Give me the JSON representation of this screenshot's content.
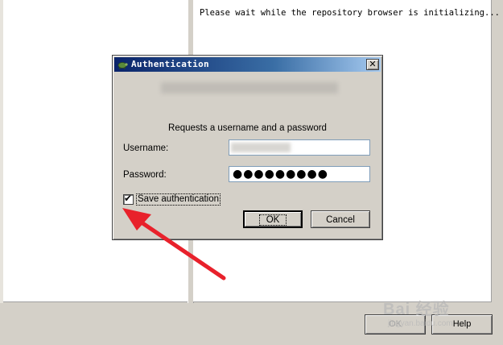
{
  "background": {
    "status_message": "Please wait while the repository browser is initializing...",
    "ok_label": "OK",
    "help_label": "Help"
  },
  "dialog": {
    "title": "Authentication",
    "close_glyph": "✕",
    "realm_text": "Requests a username and a password",
    "username_label": "Username:",
    "username_value": "",
    "password_label": "Password:",
    "password_value": "●●●●●●●●●",
    "save_auth_label": "Save authentication",
    "save_auth_checked": true,
    "ok_label": "OK",
    "cancel_label": "Cancel"
  },
  "annotation": {
    "arrow_color": "#e8212b"
  },
  "watermark": {
    "main": "Bai 经验",
    "sub": "jingyan.baidu.com"
  },
  "icons": [
    "tortoise-icon",
    "close-icon",
    "checkbox-check-icon",
    "arrow-annotation"
  ]
}
